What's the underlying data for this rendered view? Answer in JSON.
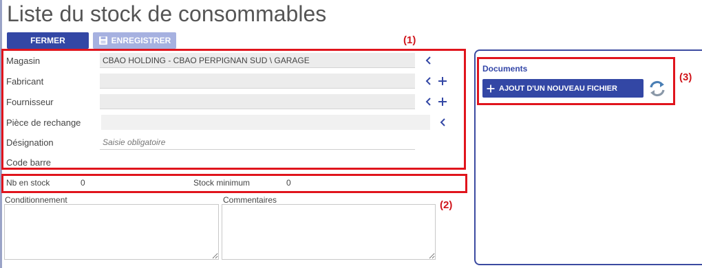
{
  "page": {
    "title": "Liste du stock de consommables"
  },
  "toolbar": {
    "close_label": "FERMER",
    "save_label": "ENREGISTRER"
  },
  "annotations": {
    "a1": "(1)",
    "a2": "(2)",
    "a3": "(3)"
  },
  "form": {
    "magasin": {
      "label": "Magasin",
      "value": "CBAO HOLDING - CBAO PERPIGNAN SUD \\ GARAGE"
    },
    "fabricant": {
      "label": "Fabricant",
      "value": ""
    },
    "fournisseur": {
      "label": "Fournisseur",
      "value": ""
    },
    "piece": {
      "label": "Pièce de rechange",
      "value": ""
    },
    "designation": {
      "label": "Désignation",
      "placeholder": "Saisie obligatoire"
    },
    "code_barre": {
      "label": "Code barre"
    }
  },
  "stock": {
    "nb_label": "Nb en stock",
    "nb_value": "0",
    "min_label": "Stock minimum",
    "min_value": "0"
  },
  "notes": {
    "conditionnement_label": "Conditionnement",
    "commentaires_label": "Commentaires"
  },
  "documents": {
    "title": "Documents",
    "add_label": "AJOUT D'UN NOUVEAU FICHIER"
  },
  "colors": {
    "primary": "#3347a5",
    "primary_disabled": "#a6b1e0",
    "annotation_red": "#e0141c",
    "field_bg": "#ececec"
  },
  "icons": [
    "save-icon",
    "chevron-left-icon",
    "plus-icon",
    "refresh-icon"
  ]
}
